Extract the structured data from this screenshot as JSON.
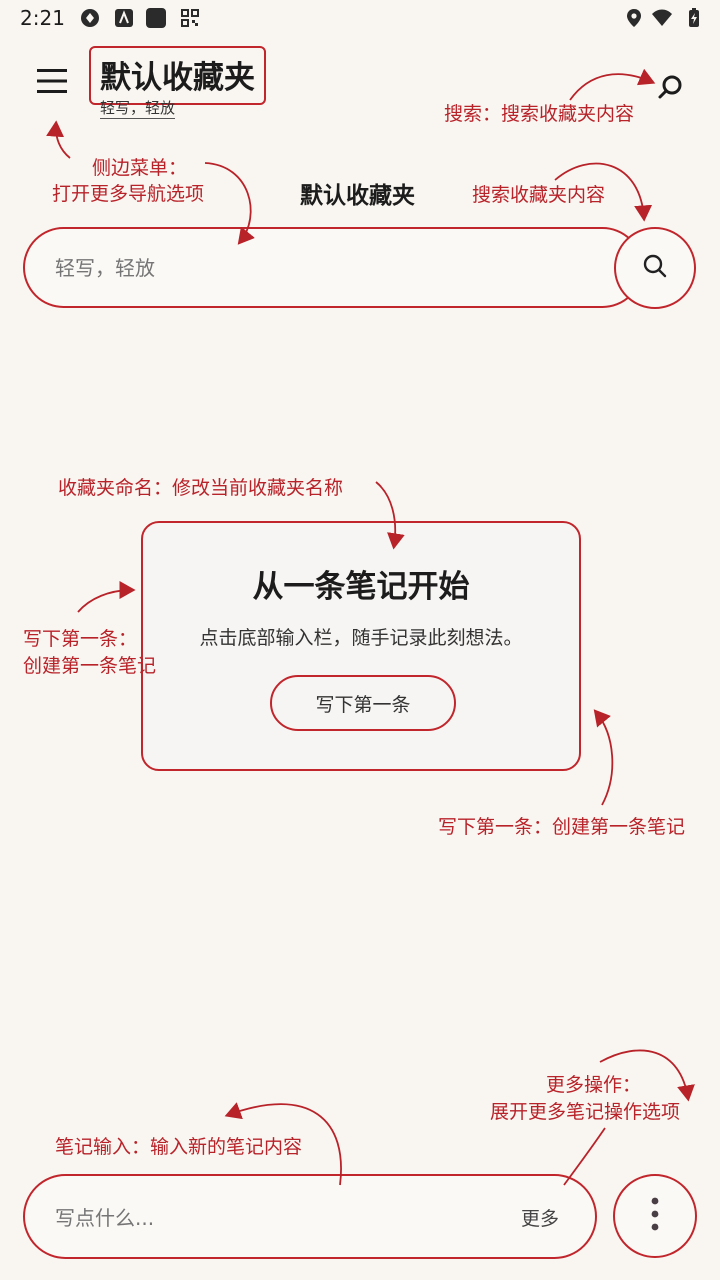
{
  "status": {
    "time": "2:21"
  },
  "header": {
    "title": "默认收藏夹",
    "subtitle": "轻写，轻放"
  },
  "center_title": "默认收藏夹",
  "search": {
    "placeholder": "轻写，轻放"
  },
  "empty_state": {
    "title": "从一条笔记开始",
    "body": "点击底部输入栏，随手记录此刻想法。",
    "button": "写下第一条"
  },
  "composer": {
    "placeholder": "写点什么...",
    "more_label": "更多"
  },
  "annotations": {
    "menu_title": "侧边菜单：",
    "menu_desc": "打开更多导航选项",
    "search_top": "搜索：搜索收藏夹内容",
    "search_mid": "搜索收藏夹内容",
    "rename": "收藏夹命名：修改当前收藏夹名称",
    "write_left_title": "写下第一条：",
    "write_left_desc": "创建第一条笔记",
    "write_right": "写下第一条：创建第一条笔记",
    "more_title": "更多操作：",
    "more_desc": "展开更多笔记操作选项",
    "note_input": "笔记输入：输入新的笔记内容"
  },
  "colors": {
    "accent": "#c0262c",
    "background": "#f9f6f1"
  }
}
